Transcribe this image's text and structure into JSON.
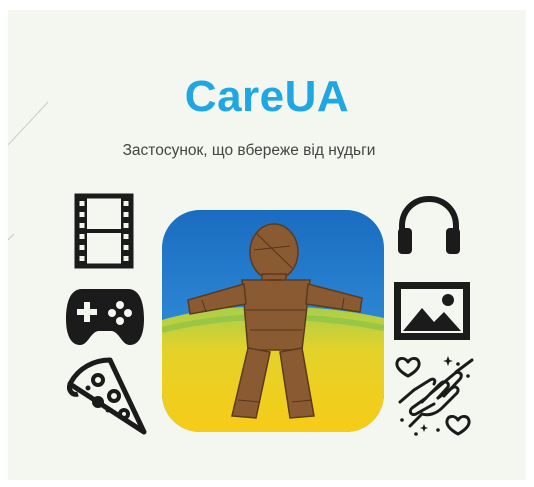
{
  "slide": {
    "title": "CareUA",
    "subtitle": "Застосунок, що вбереже від нудьги"
  },
  "icons": {
    "left": [
      "film-strip-icon",
      "gamepad-icon",
      "pizza-icon"
    ],
    "right": [
      "headphones-icon",
      "image-icon",
      "heart-hands-icon"
    ]
  },
  "colors": {
    "title": "#1ea7e3",
    "icon": "#1b1b1b",
    "flag_blue": "#1f74c4",
    "flag_yellow": "#f5cc1a",
    "straw_doll": "#8a5a32"
  }
}
